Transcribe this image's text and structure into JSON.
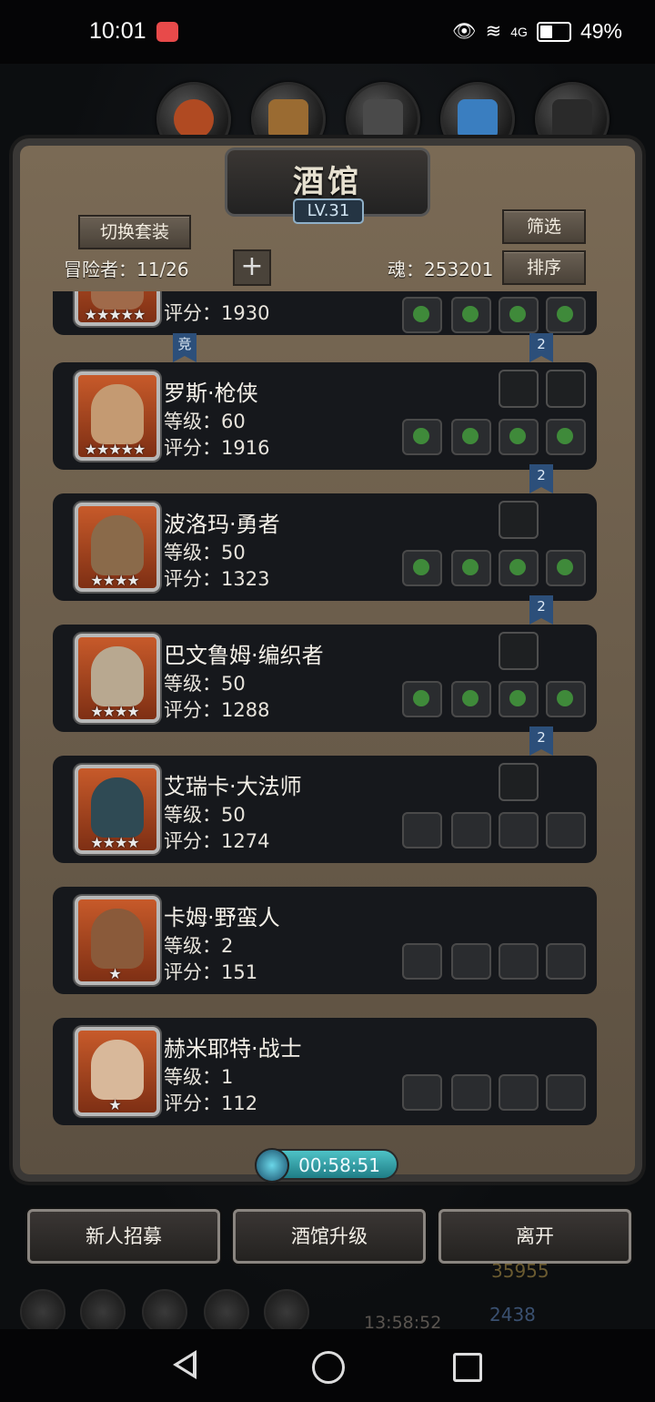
{
  "status_bar": {
    "time": "10:01",
    "battery": "49%",
    "network": "4G"
  },
  "header": {
    "title": "酒馆",
    "level": "LV.31",
    "switch_outfit": "切换套装",
    "filter": "筛选",
    "sort": "排序"
  },
  "info": {
    "adventurers": "冒险者：11/26",
    "soul": "魂：253201"
  },
  "heroes": [
    {
      "name": "",
      "level": "",
      "score": "评分：1930",
      "stars": "★★★★★",
      "badge": "竞"
    },
    {
      "name": "罗斯·枪侠",
      "level": "等级：60",
      "score": "评分：1916",
      "stars": "★★★★★",
      "ribbon": "2"
    },
    {
      "name": "波洛玛·勇者",
      "level": "等级：50",
      "score": "评分：1323",
      "stars": "★★★★",
      "ribbon": "2"
    },
    {
      "name": "巴文鲁姆·编织者",
      "level": "等级：50",
      "score": "评分：1288",
      "stars": "★★★★",
      "ribbon": "2"
    },
    {
      "name": "艾瑞卡·大法师",
      "level": "等级：50",
      "score": "评分：1274",
      "stars": "★★★★",
      "ribbon": "2"
    },
    {
      "name": "卡姆·野蛮人",
      "level": "等级：2",
      "score": "评分：151",
      "stars": "★"
    },
    {
      "name": "赫米耶特·战士",
      "level": "等级：1",
      "score": "评分：112",
      "stars": "★"
    }
  ],
  "timer": "00:58:51",
  "buttons": {
    "recruit": "新人招募",
    "upgrade": "酒馆升级",
    "leave": "离开"
  },
  "background": {
    "gold": "35955",
    "gems": "2438",
    "clock": "13:58:52"
  },
  "colors": {
    "accent_teal": "#4ec2c6",
    "ribbon_blue": "#2c4f7a",
    "portrait_orange": "#c75a2a"
  }
}
